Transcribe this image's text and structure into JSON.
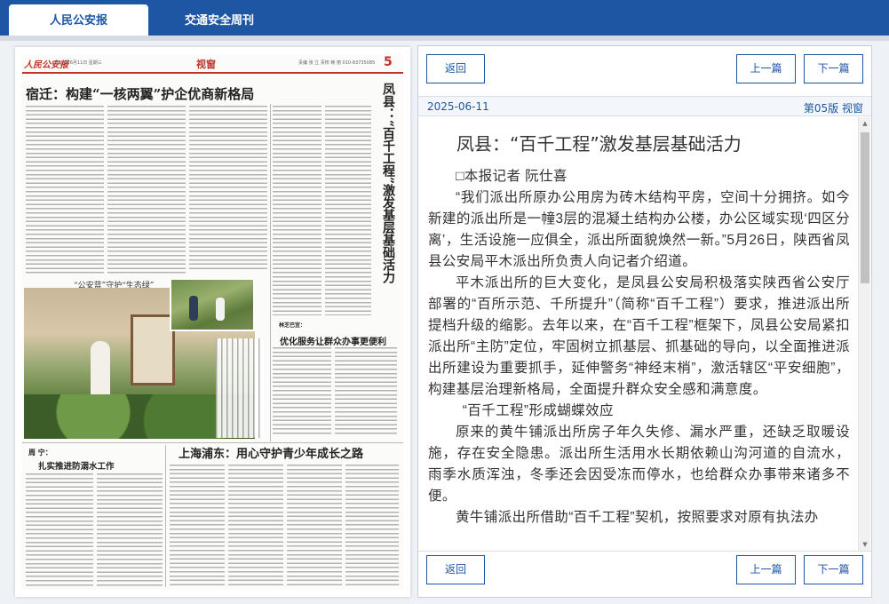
{
  "tabs": [
    {
      "label": "人民公安报",
      "active": true
    },
    {
      "label": "交通安全周刊",
      "active": false
    }
  ],
  "newspaper": {
    "logo": "人民公安报",
    "date_line": "2025年6月11日  星期三",
    "section": "视窗",
    "editors": "责编 张 立  责校 韩 丽  010-83735085",
    "page_number": "5",
    "headline_main": "宿迁：构建“一核两翼”护企优商新格局",
    "headline_side": "凤县：“百千工程”激发基层基础活力",
    "banner_quote": "“公安蓝”守护“生态绿”",
    "headline_lin": "林芝巴宜：",
    "headline_lin2": "优化服务让群众办事更便利",
    "headline_shanghai": "上海浦东：用心守护青少年成长之路",
    "headline_ningde_a": "周 宁：",
    "headline_ningde_b": "扎实推进防溺水工作"
  },
  "reader": {
    "back_label": "返回",
    "prev_label": "上一篇",
    "next_label": "下一篇",
    "date": "2025-06-11",
    "edition": "第05版 视窗",
    "article": {
      "title": "凤县：“百千工程”激发基层基础活力",
      "paragraphs": [
        "□本报记者 阮仕喜",
        "“我们派出所原办公用房为砖木结构平房，空间十分拥挤。如今新建的派出所是一幢3层的混凝土结构办公楼，办公区域实现‘四区分离’，生活设施一应俱全，派出所面貌焕然一新。”5月26日，陕西省凤县公安局平木派出所负责人向记者介绍道。",
        "平木派出所的巨大变化，是凤县公安局积极落实陕西省公安厅部署的“百所示范、千所提升”（简称“百千工程”）要求，推进派出所提档升级的缩影。去年以来，在“百千工程”框架下，凤县公安局紧扣派出所“主防”定位，牢固树立抓基层、抓基础的导向，以全面推进派出所建设为重要抓手，延伸警务“神经末梢”，激活辖区“平安细胞”，构建基层治理新格局，全面提升群众安全感和满意度。",
        "“百千工程”形成蝴蝶效应",
        "原来的黄牛铺派出所房子年久失修、漏水严重，还缺乏取暖设施，存在安全隐患。派出所生活用水长期依赖山沟河道的自流水，雨季水质浑浊，冬季还会因受冻而停水，也给群众办事带来诸多不便。",
        "黄牛铺派出所借助“百千工程”契机，按照要求对原有执法办"
      ]
    }
  },
  "colors": {
    "brand_blue": "#1f56a3",
    "paper_red": "#c0322a"
  },
  "icons": {
    "scroll_up": "▲",
    "scroll_down": "▼"
  }
}
